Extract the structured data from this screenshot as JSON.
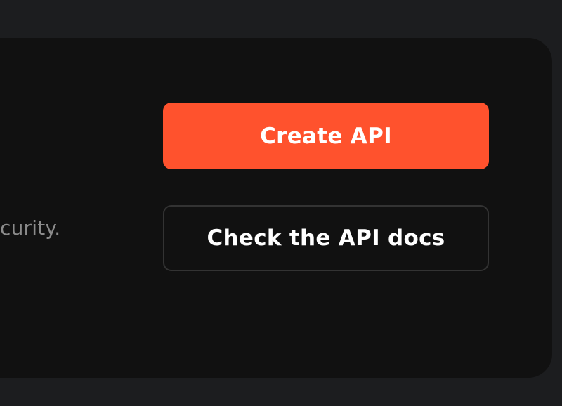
{
  "card": {
    "description_fragment": "curity."
  },
  "actions": {
    "create_api_label": "Create API",
    "check_docs_label": "Check the API docs"
  },
  "colors": {
    "page_background": "#1c1d1f",
    "card_background": "#111111",
    "primary_accent": "#ff522d",
    "secondary_border": "#333333",
    "muted_text": "#8b8b8b",
    "button_text": "#ffffff"
  }
}
